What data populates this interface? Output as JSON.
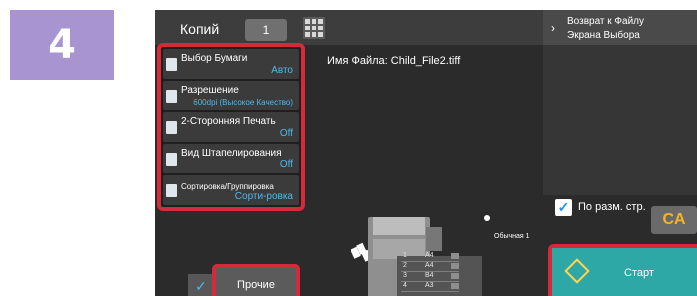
{
  "step_number": "4",
  "copies": {
    "label": "Копий",
    "value": "1"
  },
  "file_name": "Имя Файла:  Child_File2.tiff",
  "functions": [
    {
      "label": "Выбор Бумаги",
      "value": "Авто"
    },
    {
      "label": "Разрешение",
      "value": "600dpi (Высокое Качество)"
    },
    {
      "label": "2-Сторонняя Печать",
      "value": "Off"
    },
    {
      "label": "Вид Штапелирования",
      "value": "Off"
    },
    {
      "label": "Сортировка/Группировка",
      "value": "Сорти-ровка"
    }
  ],
  "return_button": {
    "line1": "Возврат к Файлу",
    "line2": "Экрана Выбора"
  },
  "fit_to_page": {
    "label": "По разм. стр.",
    "checked": true
  },
  "ca_button": "CA",
  "machine": {
    "trays": [
      {
        "num": "1",
        "size": "A4"
      },
      {
        "num": "2",
        "size": "A4"
      },
      {
        "num": "3",
        "size": "B4"
      },
      {
        "num": "4",
        "size": "A3"
      }
    ],
    "tray_name": "Обычная 1"
  },
  "other_button": "Прочие",
  "start_button": "Старт",
  "colors": {
    "badge": "#a794d1",
    "highlight": "#d42a3a",
    "value_text": "#4fb7ee",
    "start": "#2ea7a7"
  }
}
